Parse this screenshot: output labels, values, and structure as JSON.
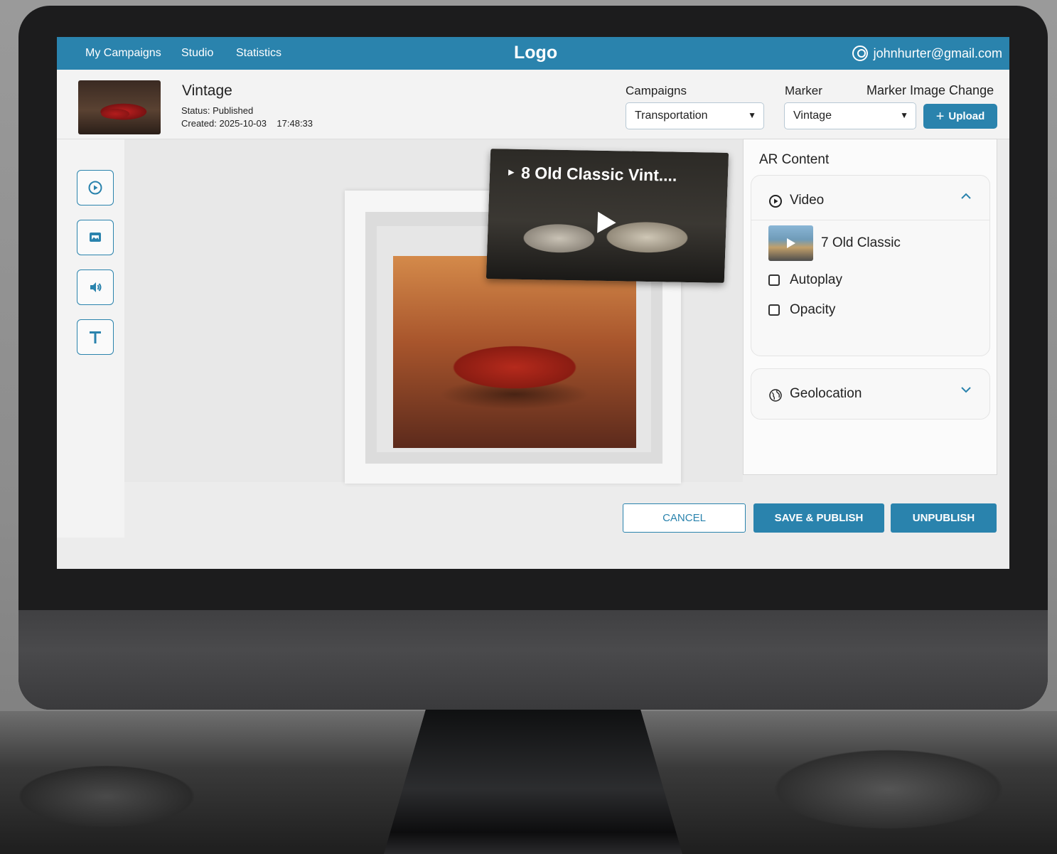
{
  "nav": {
    "items": [
      "My Campaigns",
      "Studio",
      "Statistics"
    ],
    "logo": "Logo",
    "user_email": "johnhurter@gmail.com"
  },
  "campaign": {
    "name": "Vintage",
    "status": "Status: Published",
    "created": "Created: 2025-10-03    17:48:33"
  },
  "fields": {
    "campaigns_label": "Campaigns",
    "campaigns_value": "Transportation",
    "marker_label": "Marker",
    "marker_value": "Vintage",
    "marker_image_label": "Marker Image Change",
    "upload_label": "Upload"
  },
  "tools": [
    "video-tool-icon",
    "image-tool-icon",
    "audio-tool-icon",
    "text-tool-icon"
  ],
  "preview": {
    "video_title": "8 Old Classic Vint...."
  },
  "ar_panel": {
    "title": "AR Content",
    "video_section": {
      "label": "Video",
      "item_name": "7 Old Classic",
      "options": [
        "Autoplay",
        "Opacity"
      ]
    },
    "geolocation_section": {
      "label": "Geolocation"
    }
  },
  "actions": {
    "cancel": "CANCEL",
    "save_publish": "SAVE & PUBLISH",
    "unpublish": "UNPUBLISH"
  },
  "colors": {
    "accent": "#2a83ad"
  }
}
